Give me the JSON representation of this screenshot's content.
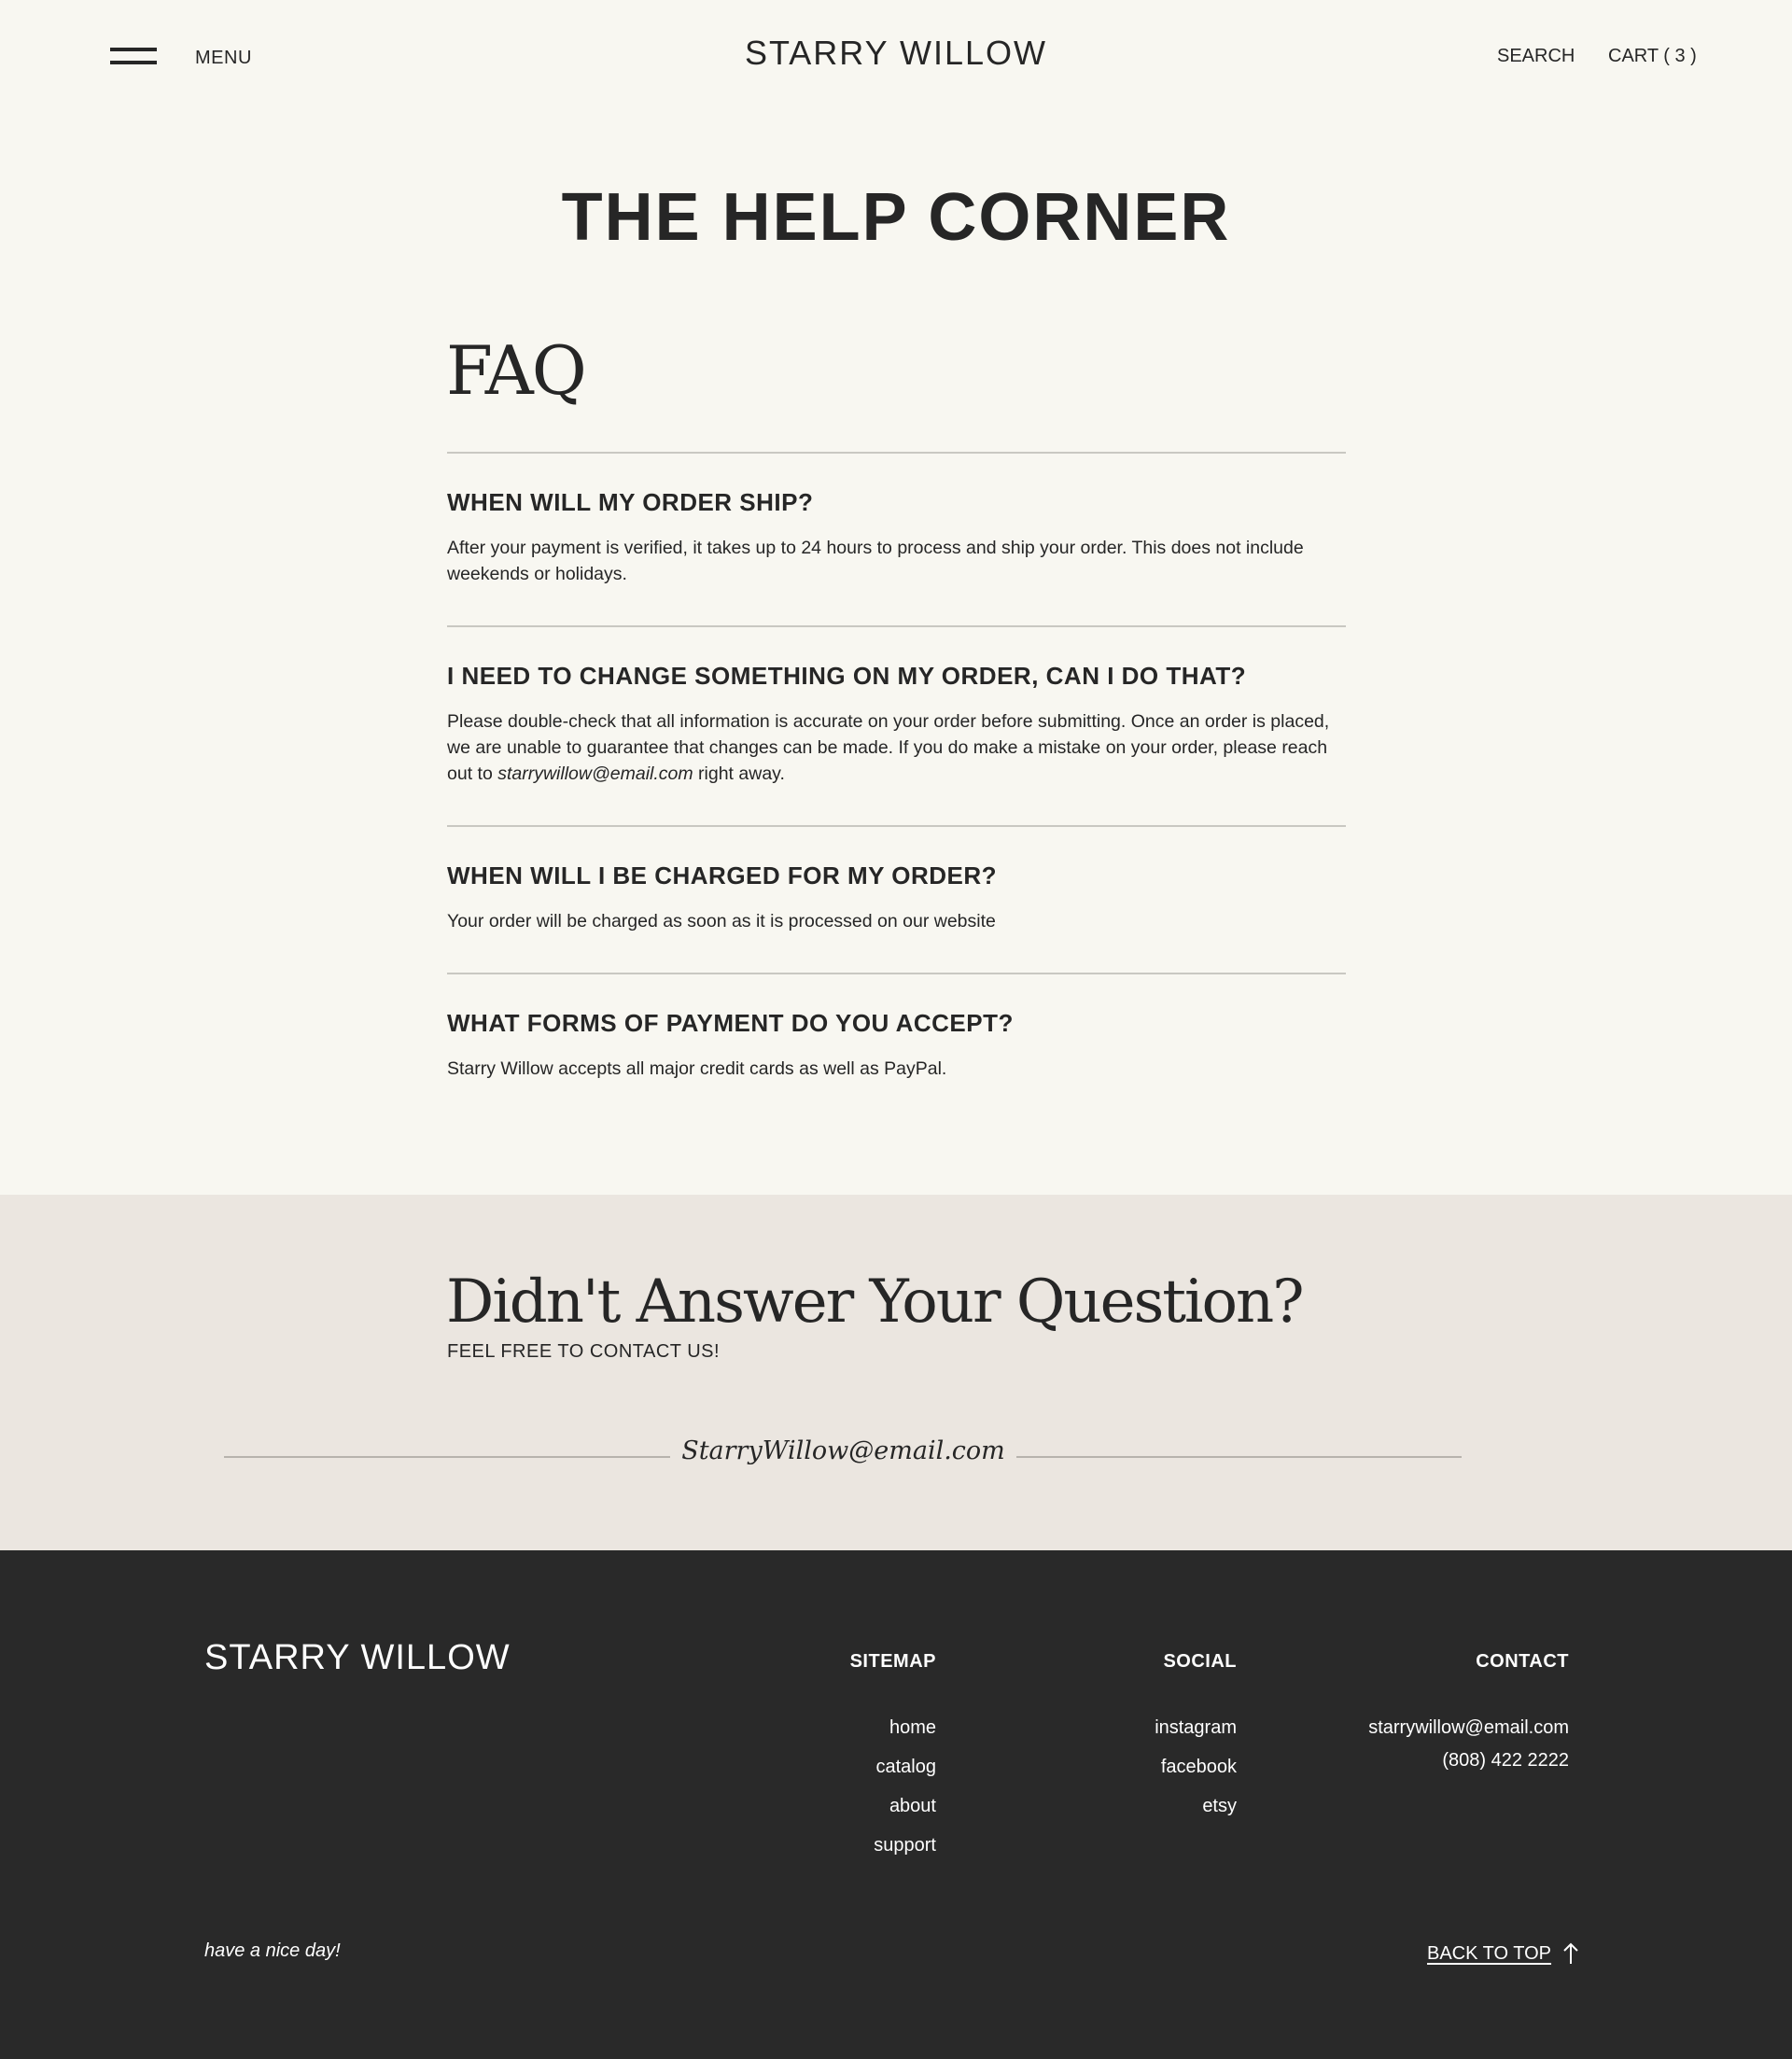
{
  "header": {
    "menu_label": "MENU",
    "brand": "STARRY WILLOW",
    "search_label": "SEARCH",
    "cart_label": "CART ( 3 )"
  },
  "main": {
    "title": "THE HELP CORNER",
    "faq_heading": "FAQ",
    "faqs": [
      {
        "question": "WHEN WILL MY ORDER SHIP?",
        "answer": "After your payment is verified, it takes up to 24 hours to process and ship your order. This does not include weekends or holidays."
      },
      {
        "question": "I NEED TO CHANGE SOMETHING ON MY ORDER, CAN I DO THAT?",
        "answer_before": "Please double-check that all information is accurate on your order before submitting. Once an order is placed, we are unable to guarantee that changes can be made. If you do make a mistake on your order, please reach out to ",
        "answer_email": "starrywillow@email.com",
        "answer_after": " right away."
      },
      {
        "question": "WHEN WILL I BE CHARGED FOR MY ORDER?",
        "answer": "Your order will be charged as soon as it is processed on our website"
      },
      {
        "question": "WHAT FORMS OF PAYMENT DO YOU ACCEPT?",
        "answer": "Starry Willow accepts all major credit cards as well as PayPal."
      }
    ]
  },
  "contact_band": {
    "title": "Didn't Answer Your Question?",
    "subtitle": "FEEL FREE TO CONTACT US!",
    "email": "StarryWillow@email.com"
  },
  "footer": {
    "brand": "STARRY WILLOW",
    "sitemap": {
      "heading": "SITEMAP",
      "links": [
        "home",
        "catalog",
        "about",
        "support"
      ]
    },
    "social": {
      "heading": "SOCIAL",
      "links": [
        "instagram",
        "facebook",
        "etsy"
      ]
    },
    "contact": {
      "heading": "CONTACT",
      "email": "starrywillow@email.com",
      "phone": "(808) 422 2222"
    },
    "tagline": "have a nice day!",
    "back_to_top": "BACK TO TOP"
  },
  "colors": {
    "background": "#f8f7f1",
    "band": "#ebe6e0",
    "footer": "#292929",
    "text": "#262626"
  },
  "icons": {
    "menu": "hamburger-icon",
    "back_to_top": "arrow-up-icon"
  }
}
